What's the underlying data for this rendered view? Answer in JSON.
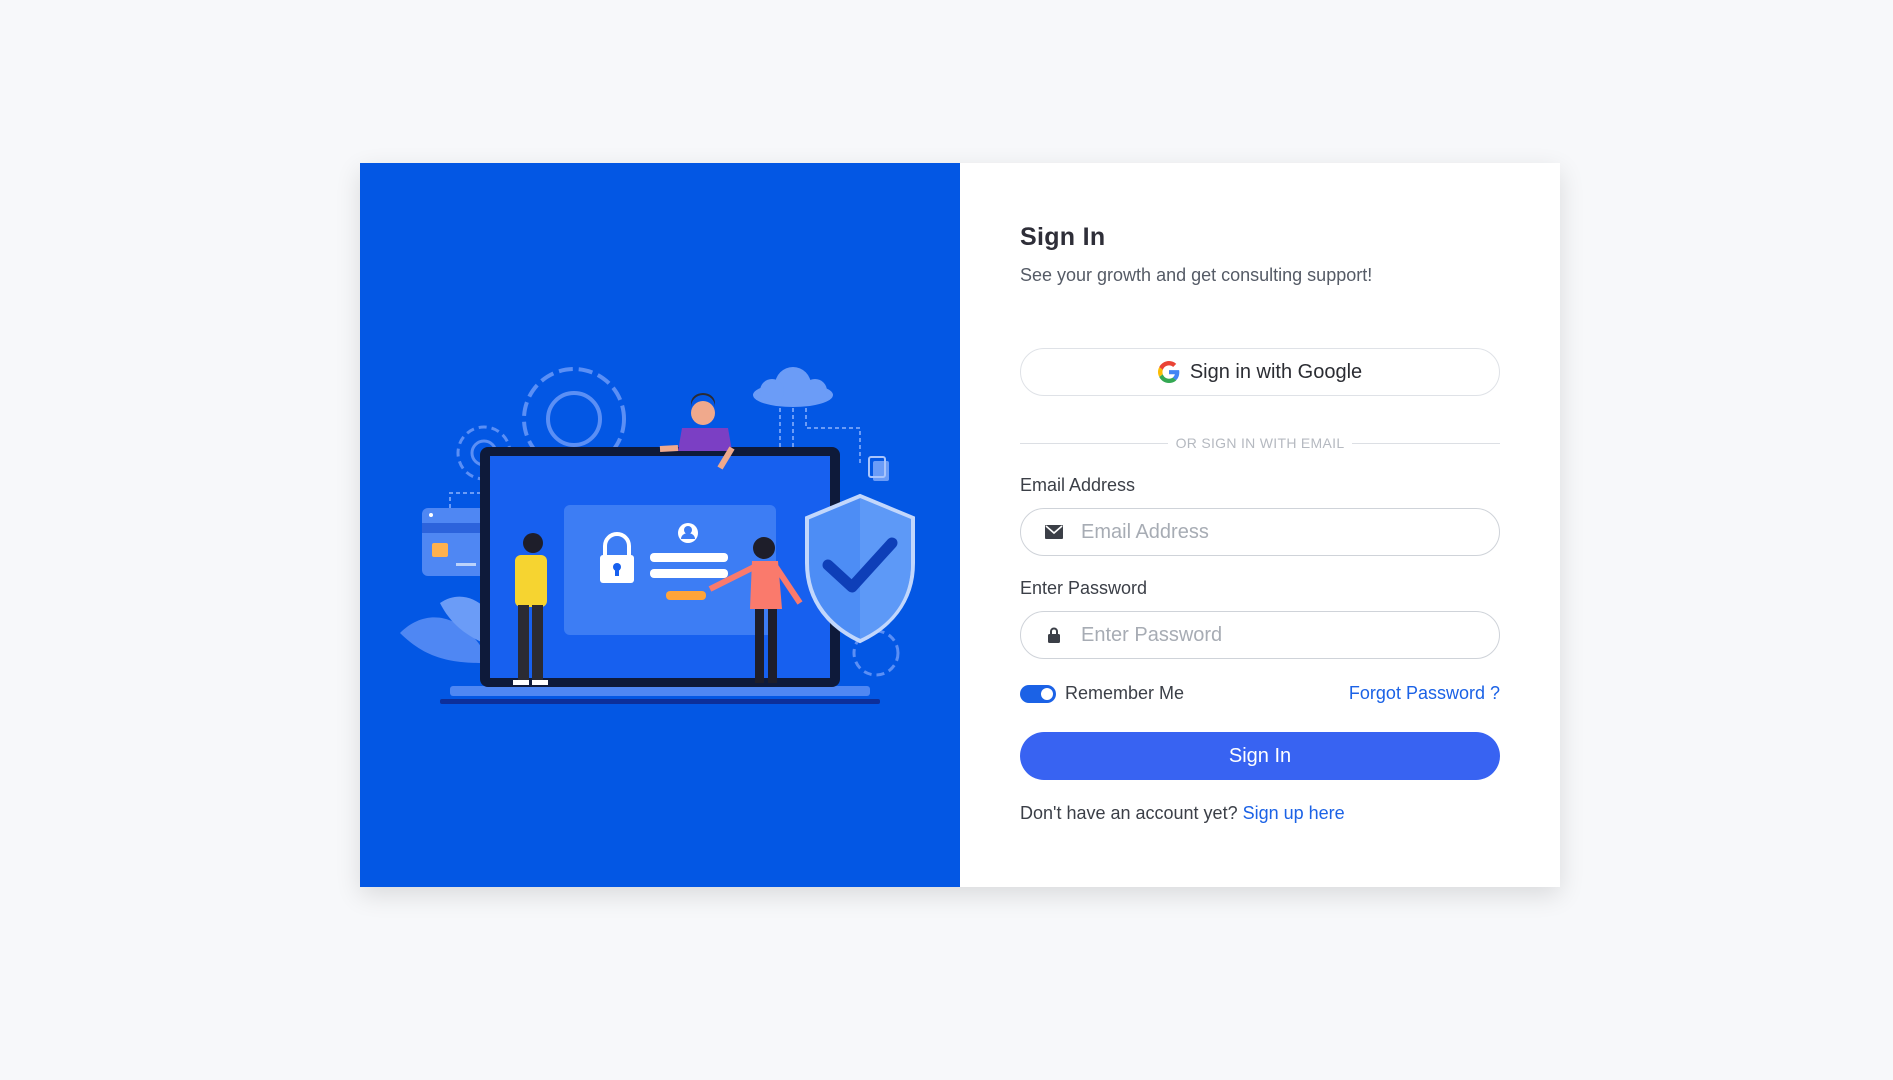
{
  "form": {
    "title": "Sign In",
    "subtitle": "See your growth and get consulting support!",
    "google_button": "Sign in with Google",
    "divider": "OR SIGN IN WITH EMAIL",
    "email_label": "Email Address",
    "email_placeholder": "Email Address",
    "password_label": "Enter Password",
    "password_placeholder": "Enter Password",
    "remember_label": "Remember Me",
    "remember_checked": true,
    "forgot_link": "Forgot Password ?",
    "submit_button": "Sign In",
    "signup_prompt": "Don't have an account yet?",
    "signup_link": "Sign up here"
  },
  "colors": {
    "illustration_bg": "#0357e4",
    "accent": "#3863f2",
    "link": "#1b62e6"
  },
  "icons": {
    "google": "google-logo-icon",
    "email": "envelope-icon",
    "password": "lock-icon"
  }
}
